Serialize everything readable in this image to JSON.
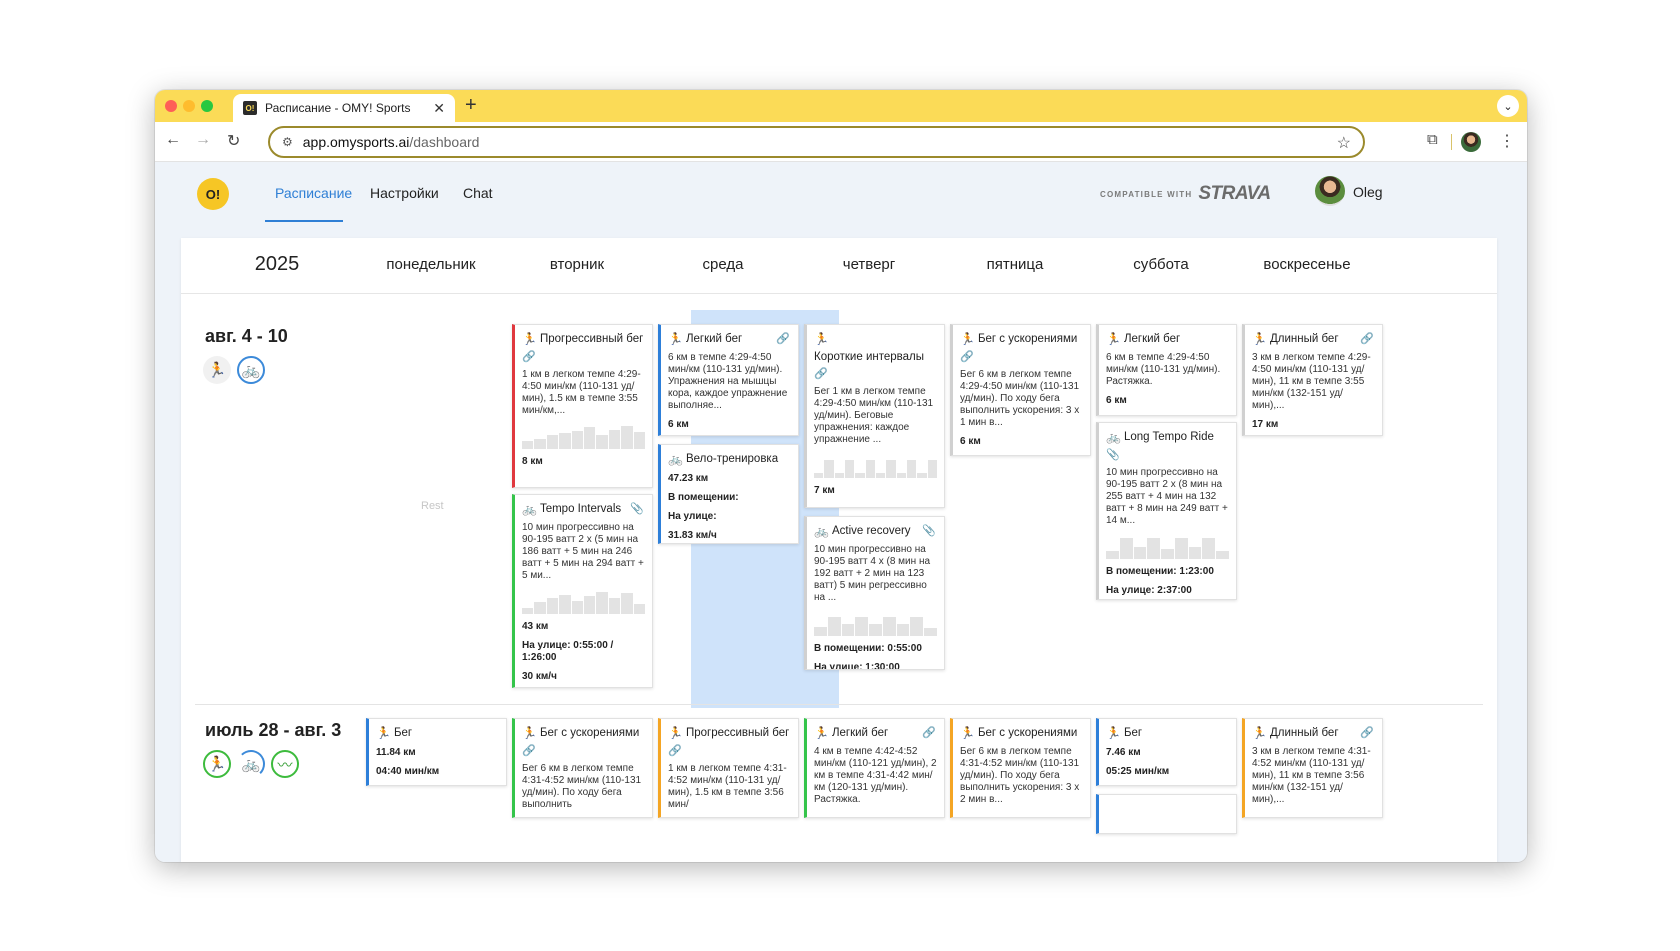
{
  "browser": {
    "tab_title": "Расписание - OMY! Sports",
    "favicon": "O!",
    "url_host": "app.omysports.ai",
    "url_path": "/dashboard"
  },
  "app": {
    "logo": "O!",
    "nav": [
      "Расписание",
      "Настройки",
      "Chat"
    ],
    "strava_small": "COMPATIBLE WITH",
    "strava_big": "STRAVA",
    "user_name": "Oleg"
  },
  "calendar": {
    "year": "2025",
    "days": [
      "понедельник",
      "вторник",
      "среда",
      "четверг",
      "пятница",
      "суббота",
      "воскресенье"
    ],
    "rest_label": "Rest",
    "weeks": [
      {
        "label": "авг. 4 - 10"
      },
      {
        "label": "июль 28 - авг. 3"
      }
    ],
    "cards": {
      "w1_tue_1": {
        "title": "Прогрессивный бег",
        "desc": "1 км в легком темпе 4:29-4:50 мин/км (110-131 уд/мин), 1.5 км в темпе 3:55 мин/км,...",
        "stat1": "8 км"
      },
      "w1_tue_2": {
        "title": "Tempo Intervals",
        "desc": "10 мин прогрессивно на 90-195 ватт 2 x (5 мин на 186 ватт + 5 мин на 246 ватт + 5 мин на 294 ватт + 5 ми...",
        "stat1": "43 км",
        "stat2": "На улице: 0:55:00 / 1:26:00",
        "stat3": "30 км/ч"
      },
      "w1_wed_1": {
        "title": "Легкий бег",
        "desc": "6 км в темпе 4:29-4:50 мин/км (110-131 уд/мин). Упражнения на мышцы кора, каждое упражнение выполняе...",
        "stat1": "6 км"
      },
      "w1_wed_2": {
        "title": "Вело-тренировка",
        "stat1": "47.23 км",
        "stat2": "В помещении:",
        "stat3": "На улице:",
        "stat4": "31.83 км/ч"
      },
      "w1_thu_1": {
        "title": "Короткие интервалы",
        "desc": "Бег 1 км в легком темпе 4:29-4:50 мин/км (110-131 уд/мин). Беговые упражнения: каждое упражнение ...",
        "stat1": "7 км"
      },
      "w1_thu_2": {
        "title": "Active recovery",
        "desc": "10 мин прогрессивно на 90-195 ватт 4 x (8 мин на 192 ватт + 2 мин на 123 ватт) 5 мин регрессивно на ...",
        "stat1": "В помещении: 0:55:00",
        "stat2": "На улице: 1:30:00"
      },
      "w1_fri_1": {
        "title": "Бег с ускорениями",
        "desc": "Бег 6 км в легком темпе 4:29-4:50 мин/км (110-131 уд/мин). По ходу бега выполнить ускорения: 3 x 1 мин в...",
        "stat1": "6 км"
      },
      "w1_sat_1": {
        "title": "Легкий бег",
        "desc": "6 км в темпе 4:29-4:50 мин/км (110-131 уд/мин). Растяжка.",
        "stat1": "6 км"
      },
      "w1_sat_2": {
        "title": "Long Tempo Ride",
        "desc": "10 мин прогрессивно на 90-195 ватт 2 x (8 мин на 255 ватт + 4 мин на 132 ватт + 8 мин на 249 ватт + 14 м...",
        "stat1": "В помещении: 1:23:00",
        "stat2": "На улице: 2:37:00"
      },
      "w1_sun_1": {
        "title": "Длинный бег",
        "desc": "3 км в легком темпе 4:29-4:50 мин/км (110-131 уд/мин), 11 км в темпе 3:55 мин/км (132-151 уд/мин),...",
        "stat1": "17 км"
      },
      "w2_mon_1": {
        "title": "Бег",
        "stat1": "11.84 км",
        "stat2": "04:40 мин/км"
      },
      "w2_tue_1": {
        "title": "Бег с ускорениями",
        "desc": "Бег 6 км в легком темпе 4:31-4:52 мин/км (110-131 уд/мин). По ходу бега выполнить"
      },
      "w2_wed_1": {
        "title": "Прогрессивный бег",
        "desc": "1 км в легком темпе 4:31-4:52 мин/км (110-131 уд/мин), 1.5 км в темпе 3:56 мин/"
      },
      "w2_thu_1": {
        "title": "Легкий бег",
        "desc": "4 км в темпе 4:42-4:52 мин/км (110-121 уд/мин), 2 км в темпе 4:31-4:42 мин/км (120-131 уд/мин). Растяжка."
      },
      "w2_fri_1": {
        "title": "Бег с ускорениями",
        "desc": "Бег 6 км в легком темпе 4:31-4:52 мин/км (110-131 уд/мин). По ходу бега выполнить ускорения: 3 x 2 мин в..."
      },
      "w2_sat_1": {
        "title": "Бег",
        "stat1": "7.46 км",
        "stat2": "05:25 мин/км"
      },
      "w2_sun_1": {
        "title": "Длинный бег",
        "desc": "3 км в легком темпе 4:31-4:52 мин/км (110-131 уд/мин), 11 км в темпе 3:56 мин/км (132-151 уд/мин),..."
      }
    }
  },
  "colors": {
    "tabbar": "#fbdb57",
    "accent_blue": "#2f7fd5",
    "today_highlight": "#cfe3fa",
    "card_red": "#e0383e",
    "card_green": "#34c44a",
    "card_blue": "#2d7fd9",
    "card_orange": "#f4a524"
  },
  "icons": {
    "run": "runner-icon",
    "bike": "bike-icon",
    "swim": "swim-icon",
    "link": "link-icon",
    "attach": "paperclip-icon"
  }
}
